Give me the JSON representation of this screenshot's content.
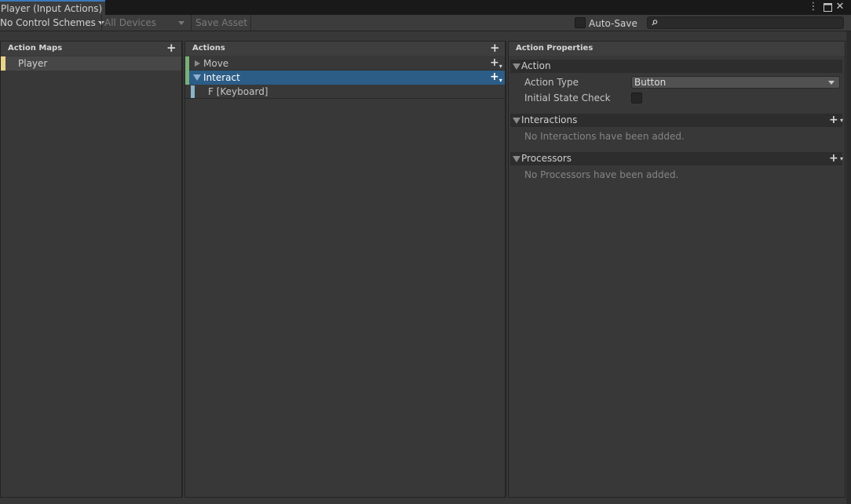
{
  "window": {
    "tab_title": "Player (Input Actions)",
    "controls": {
      "menu_icon": "more-vert-icon",
      "maximize_icon": "maximize-icon",
      "close_icon": "close-icon"
    }
  },
  "toolbar": {
    "control_schemes": "No Control Schemes",
    "devices": "All Devices",
    "save_asset": "Save Asset",
    "auto_save_label": "Auto-Save",
    "auto_save_checked": false,
    "search_placeholder": "",
    "search_icon": "search-icon"
  },
  "action_maps": {
    "header": "Action Maps",
    "items": [
      {
        "label": "Player",
        "selected": true
      }
    ]
  },
  "actions": {
    "header": "Actions",
    "items": [
      {
        "label": "Move",
        "expanded": false,
        "selected": false
      },
      {
        "label": "Interact",
        "expanded": true,
        "selected": true
      }
    ],
    "bindings": [
      {
        "label": "F [Keyboard]"
      }
    ]
  },
  "properties": {
    "header": "Action Properties",
    "action_section": "Action",
    "action_type_label": "Action Type",
    "action_type_value": "Button",
    "initial_state_label": "Initial State Check",
    "initial_state_checked": false,
    "interactions_section": "Interactions",
    "interactions_empty": "No Interactions have been added.",
    "processors_section": "Processors",
    "processors_empty": "No Processors have been added."
  },
  "colors": {
    "tab_accent": "#3a79bb",
    "selection": "#2c5d87",
    "map_marker": "#e8d48a",
    "action_marker": "#78b07a",
    "binding_marker": "#8db3c8"
  }
}
